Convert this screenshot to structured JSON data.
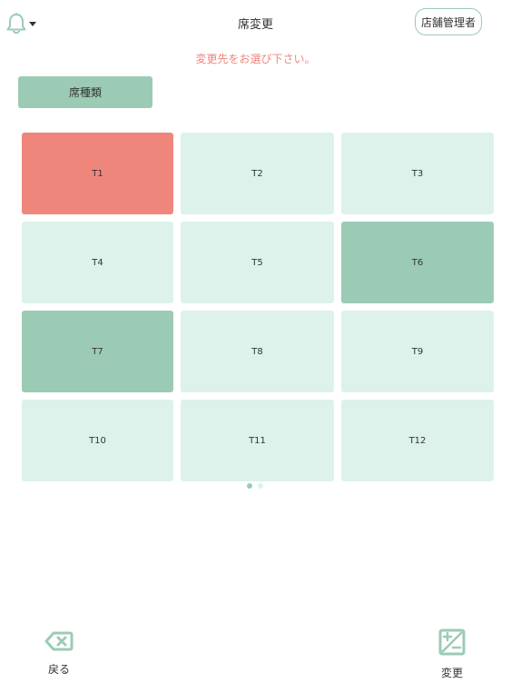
{
  "header": {
    "title": "席変更",
    "admin_label": "店舗管理者",
    "bell_icon": "bell-icon"
  },
  "instruction": "変更先をお選び下さい。",
  "seat_type_button": "席種類",
  "colors": {
    "accent": "#9ccbb5",
    "free": "#dcf2eb",
    "occupied": "#9ccbb5",
    "current": "#ef867c",
    "instruction": "#ef867c"
  },
  "tables": [
    {
      "label": "T1",
      "status": "current"
    },
    {
      "label": "T2",
      "status": "free"
    },
    {
      "label": "T3",
      "status": "free"
    },
    {
      "label": "T4",
      "status": "free"
    },
    {
      "label": "T5",
      "status": "free"
    },
    {
      "label": "T6",
      "status": "occupied"
    },
    {
      "label": "T7",
      "status": "occupied"
    },
    {
      "label": "T8",
      "status": "free"
    },
    {
      "label": "T9",
      "status": "free"
    },
    {
      "label": "T10",
      "status": "free"
    },
    {
      "label": "T11",
      "status": "free"
    },
    {
      "label": "T12",
      "status": "free"
    }
  ],
  "pagination": {
    "pages": 2,
    "current": 1
  },
  "footer": {
    "back_label": "戻る",
    "back_icon": "backspace-icon",
    "change_label": "変更",
    "change_icon": "plus-minus-icon"
  }
}
